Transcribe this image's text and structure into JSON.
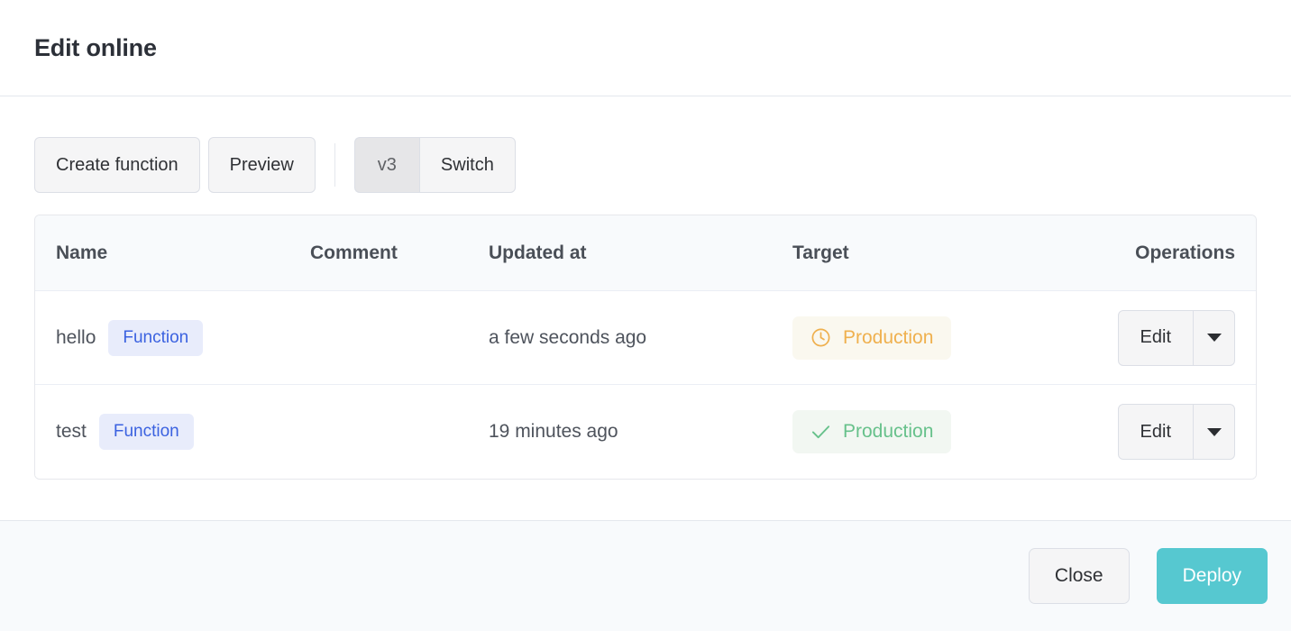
{
  "dialog": {
    "title": "Edit online"
  },
  "toolbar": {
    "create_function_label": "Create function",
    "preview_label": "Preview",
    "version_label": "v3",
    "switch_label": "Switch"
  },
  "table": {
    "columns": [
      {
        "key": "name",
        "label": "Name"
      },
      {
        "key": "comment",
        "label": "Comment"
      },
      {
        "key": "updated_at",
        "label": "Updated at"
      },
      {
        "key": "target",
        "label": "Target"
      },
      {
        "key": "operations",
        "label": "Operations"
      }
    ],
    "rows": [
      {
        "name": "hello",
        "tag": "Function",
        "comment": "",
        "updated_at": "a few seconds ago",
        "target_label": "Production",
        "target_status": "pending",
        "target_icon": "clock-icon",
        "edit_label": "Edit"
      },
      {
        "name": "test",
        "tag": "Function",
        "comment": "",
        "updated_at": "19 minutes ago",
        "target_label": "Production",
        "target_status": "success",
        "target_icon": "check-icon",
        "edit_label": "Edit"
      }
    ]
  },
  "footer": {
    "close_label": "Close",
    "deploy_label": "Deploy"
  },
  "colors": {
    "deploy_button": "#56c8d0",
    "tag_function_text": "#3b62e0",
    "tag_function_bg": "#e8ecfb",
    "badge_warning_text": "#efb04e",
    "badge_warning_bg": "#faf8ef",
    "badge_success_text": "#67c18b",
    "badge_success_bg": "#f2f7f2"
  }
}
